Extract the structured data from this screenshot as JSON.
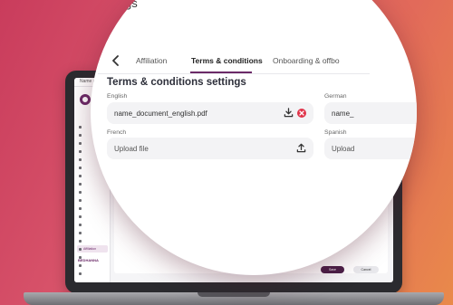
{
  "mini_app": {
    "window_title": "Name affiliation",
    "sidebar_items": [
      "",
      "",
      "",
      "",
      "",
      "",
      "",
      "",
      "",
      "",
      "",
      "",
      "",
      "",
      "",
      "Affiliation",
      "",
      "",
      ""
    ],
    "brand": "BEDHANNA",
    "brand_sub": "",
    "save_label": "Save",
    "cancel_label": "Cancel"
  },
  "header": {
    "page_title_partial": "gs"
  },
  "tabs": [
    {
      "label": "Affiliation",
      "active": false
    },
    {
      "label": "Terms & conditions",
      "active": true
    },
    {
      "label": "Onboarding & offbo",
      "active": false
    }
  ],
  "settings": {
    "title": "Terms & conditions settings",
    "fields": {
      "english": {
        "label": "English",
        "value": "name_document_english.pdf"
      },
      "german": {
        "label": "German",
        "value": "name_"
      },
      "french": {
        "label": "French",
        "value": "Upload file"
      },
      "spanish": {
        "label": "Spanish",
        "value": "Upload"
      }
    }
  },
  "colors": {
    "accent": "#6b2a68",
    "delete": "#e0344a",
    "background_start": "#c93c5c",
    "background_end": "#e98a4a"
  },
  "icons": {
    "back": "chevron-left-icon",
    "download": "download-icon",
    "delete": "close-circle-icon",
    "upload": "upload-icon"
  }
}
